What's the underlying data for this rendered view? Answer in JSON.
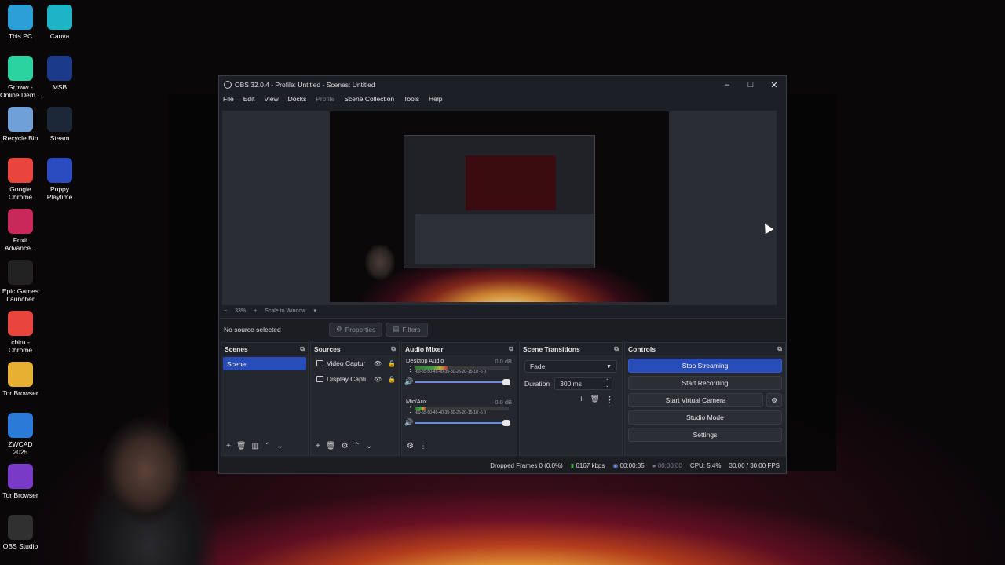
{
  "desktop": {
    "icons": [
      {
        "label": "This PC",
        "icon": "monitor-icon",
        "color": "#2a9fd8"
      },
      {
        "label": "Canva",
        "icon": "canva-icon",
        "color": "#1db4c8"
      },
      {
        "label": "Groww - Online Dem...",
        "icon": "groww-icon",
        "color": "#2bd3a0"
      },
      {
        "label": "MSB",
        "icon": "msb-icon",
        "color": "#1b3a8a"
      },
      {
        "label": "Recycle Bin",
        "icon": "recycle-bin-icon",
        "color": "#6fa0d8"
      },
      {
        "label": "Steam",
        "icon": "steam-icon",
        "color": "#1b2838"
      },
      {
        "label": "Google Chrome",
        "icon": "chrome-icon",
        "color": "#e8453c"
      },
      {
        "label": "Poppy Playtime",
        "icon": "poppy-icon",
        "color": "#2a4cc0"
      },
      {
        "label": "Foxit Advance...",
        "icon": "foxit-icon",
        "color": "#c8285a"
      },
      {
        "label": "Epic Games Launcher",
        "icon": "epic-icon",
        "color": "#222222"
      },
      {
        "label": "chiru - Chrome",
        "icon": "chrome-icon",
        "color": "#e8453c"
      },
      {
        "label": "Tor Browser",
        "icon": "folder-icon",
        "color": "#e8b030"
      },
      {
        "label": "ZWCAD 2025",
        "icon": "zwcad-icon",
        "color": "#2a7ad8"
      },
      {
        "label": "Tor Browser",
        "icon": "tor-icon",
        "color": "#7a3ac8"
      },
      {
        "label": "OBS Studio",
        "icon": "obs-icon",
        "color": "#303030"
      }
    ]
  },
  "window": {
    "title": "OBS 32.0.4 - Profile: Untitled - Scenes: Untitled",
    "controls": {
      "minimize": "–",
      "maximize": "□",
      "close": "✕"
    }
  },
  "menu": {
    "items": [
      "File",
      "Edit",
      "View",
      "Docks",
      "Profile",
      "Scene Collection",
      "Tools",
      "Help"
    ],
    "disabled": "Profile"
  },
  "preview": {
    "zoom": "33%",
    "scale_mode": "Scale to Window"
  },
  "source_bar": {
    "status": "No source selected",
    "properties": "Properties",
    "filters": "Filters"
  },
  "scenes": {
    "title": "Scenes",
    "items": [
      "Scene"
    ],
    "selected": "Scene"
  },
  "sources": {
    "title": "Sources",
    "items": [
      "Video Captur",
      "Display Capti"
    ]
  },
  "mixer": {
    "title": "Audio Mixer",
    "ticks": "-60-55-50-45-40-35-30-25-20-15-10 -5  0",
    "channels": [
      {
        "name": "Desktop Audio",
        "db": "0.0 dB",
        "level": 0.35
      },
      {
        "name": "Mic/Aux",
        "db": "0.0 dB",
        "level": 0.12
      }
    ]
  },
  "transitions": {
    "title": "Scene Transitions",
    "type": "Fade",
    "duration_label": "Duration",
    "duration": "300 ms"
  },
  "controls": {
    "title": "Controls",
    "stop_streaming": "Stop Streaming",
    "start_recording": "Start Recording",
    "start_virtual_camera": "Start Virtual Camera",
    "studio_mode": "Studio Mode",
    "settings": "Settings"
  },
  "status": {
    "dropped_frames": "Dropped Frames 0 (0.0%)",
    "bitrate": "6167 kbps",
    "stream_time": "00:00:35",
    "record_time": "00:00:00",
    "cpu": "CPU: 5.4%",
    "fps": "30.00 / 30.00 FPS"
  },
  "colors": {
    "accent": "#284cb8",
    "bg": "#1d1f26",
    "dock": "#25272e"
  }
}
